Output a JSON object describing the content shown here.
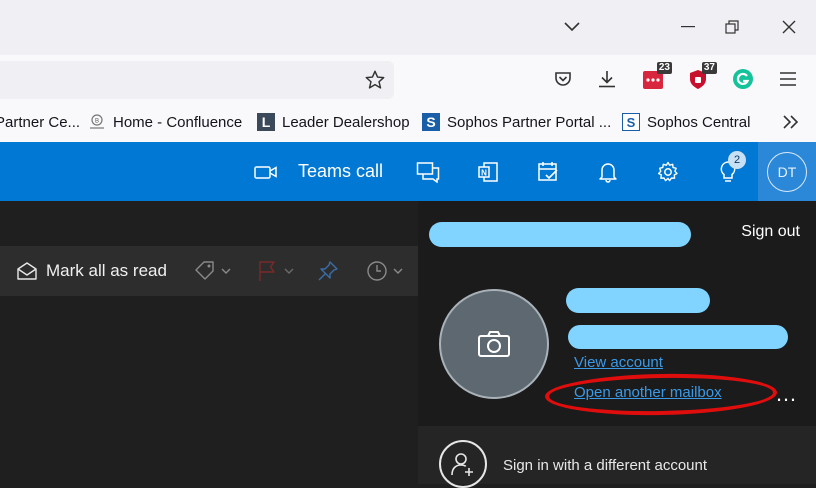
{
  "browser": {
    "bookmarks": [
      {
        "label": "Partner Ce...",
        "icon": "partner-favicon"
      },
      {
        "label": "Home - Confluence",
        "icon": "confluence-favicon"
      },
      {
        "label": "Leader Dealershop",
        "icon": "leader-favicon"
      },
      {
        "label": "Sophos Partner Portal ...",
        "icon": "sophos-favicon"
      },
      {
        "label": "Sophos Central",
        "icon": "sophos-central-favicon"
      }
    ],
    "extensions": {
      "badge_1": "23",
      "badge_2": "37"
    }
  },
  "header": {
    "teams_label": "Teams call",
    "tips_badge": "2",
    "avatar_initials": "DT"
  },
  "commandbar": {
    "mark_all_read": "Mark all as read"
  },
  "account_panel": {
    "sign_out": "Sign out",
    "view_account": "View account",
    "open_another_mailbox": "Open another mailbox",
    "sign_in_different": "Sign in with a different account",
    "more": "…"
  },
  "colors": {
    "outlook_blue": "#0078d4",
    "redaction": "#80d4ff",
    "annotation_red": "#e00d0d",
    "link": "#3a9ae8"
  }
}
